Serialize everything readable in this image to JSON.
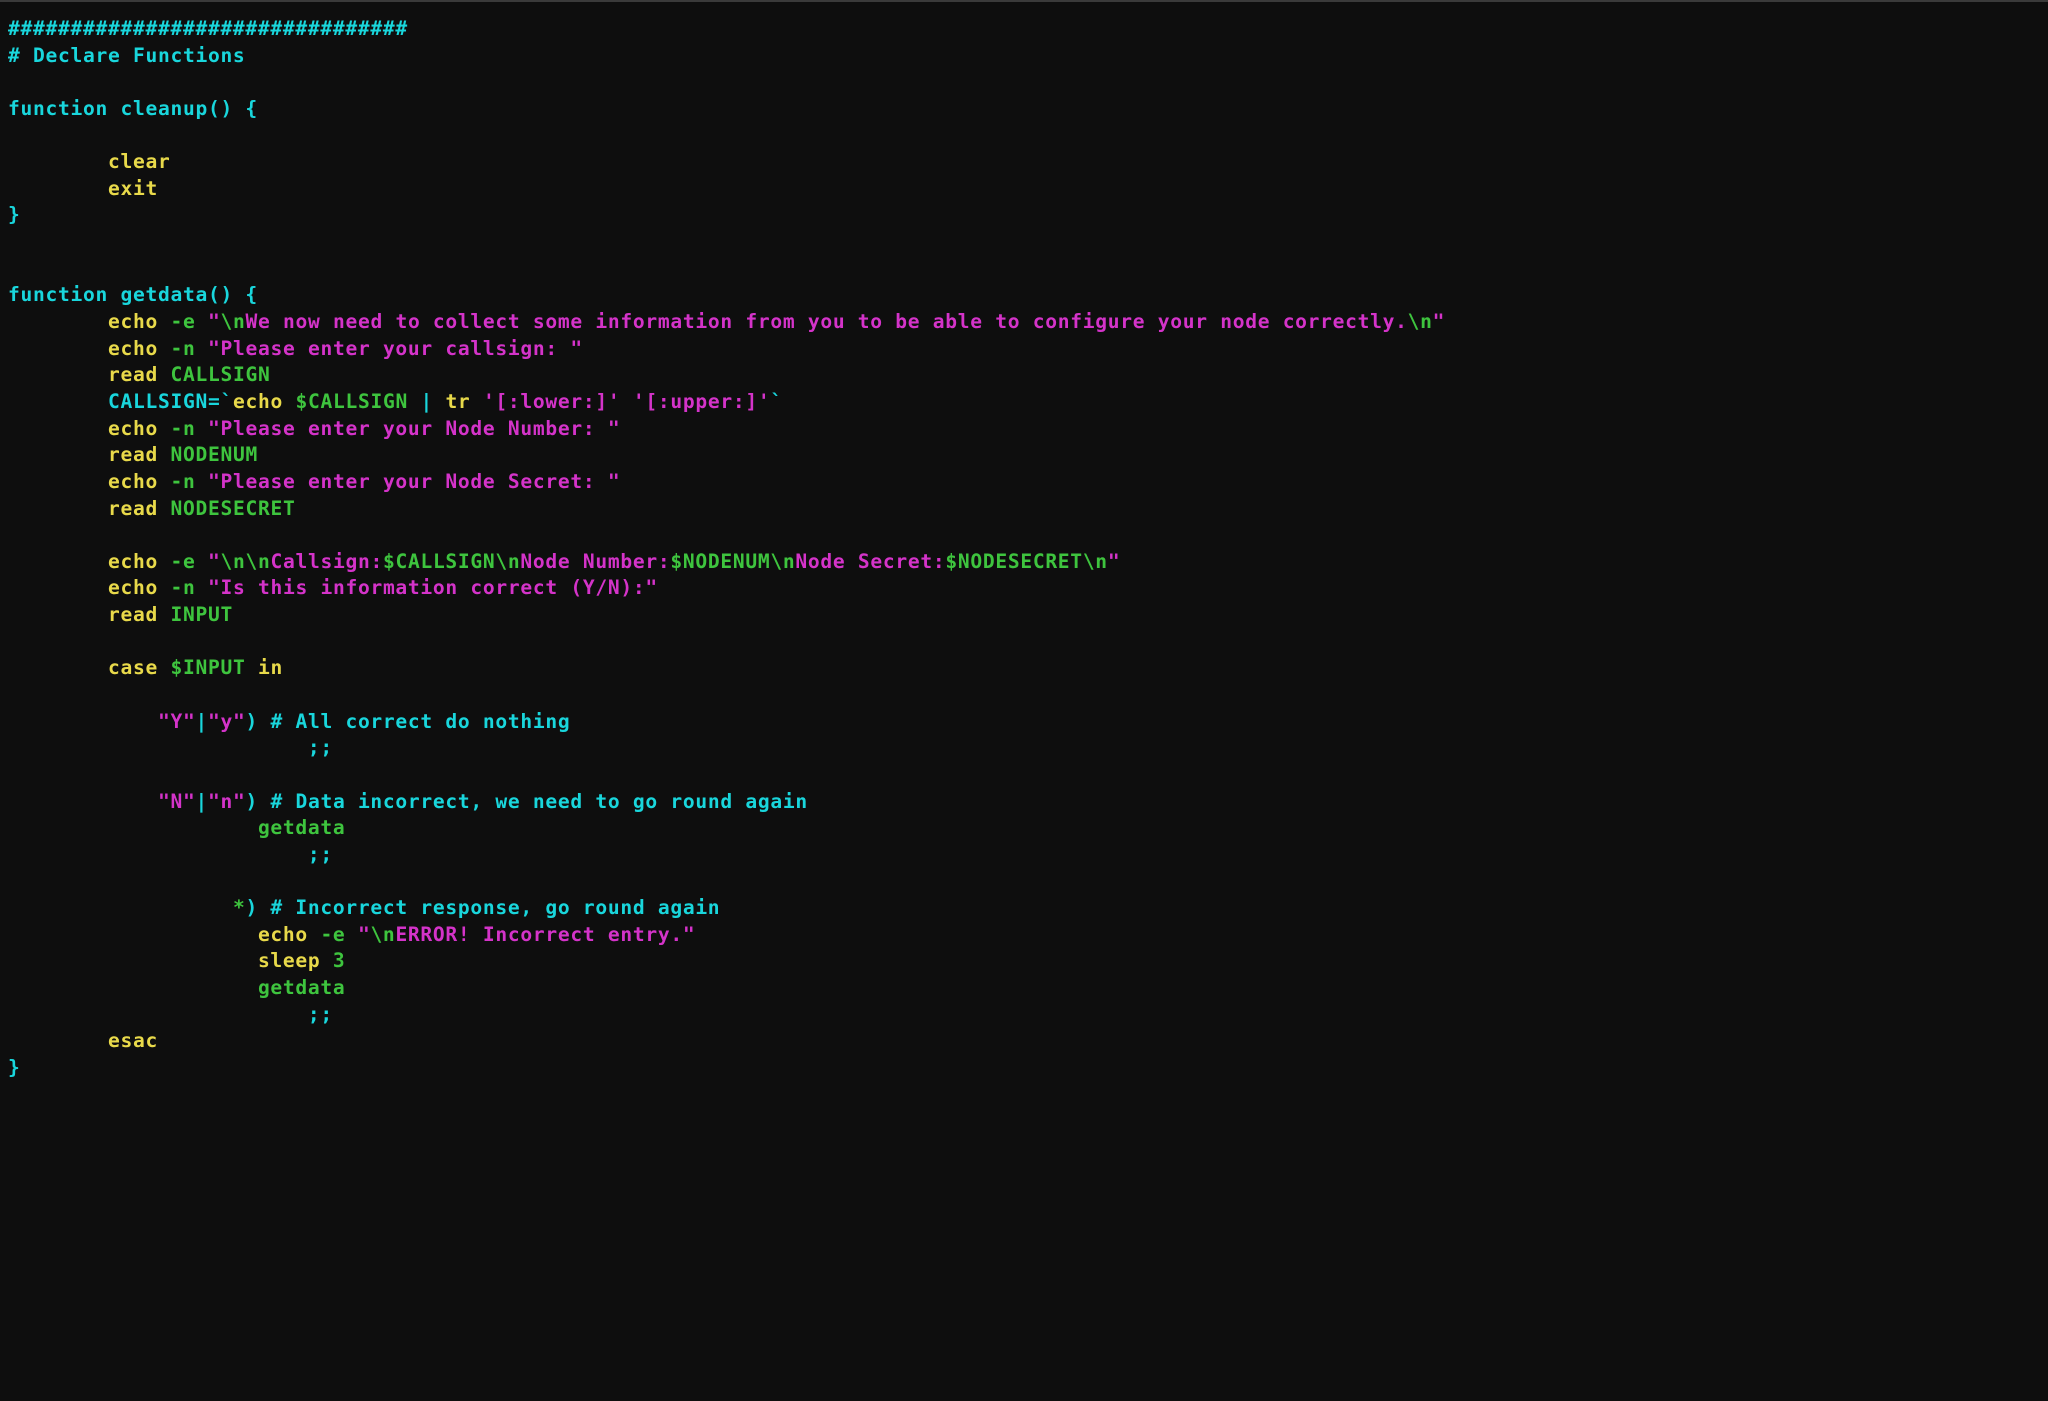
{
  "colors": {
    "background": "#0e0e0e",
    "comment": "#19d6dc",
    "keyword": "#19d6dc",
    "builtin": "#e8d94a",
    "string": "#d433c9",
    "variable": "#3ec43e"
  },
  "t": {
    "hash": "################################",
    "declare": "# Declare Functions",
    "fn_cleanup": "function cleanup() {",
    "clear": "clear",
    "exit": "exit",
    "brace_close": "}",
    "fn_getdata": "function getdata() {",
    "echo": "echo",
    "fe": "-e",
    "fn": "-n",
    "read": "read",
    "case": "case",
    "in": "in",
    "esac": "esac",
    "sleep": "sleep",
    "three": "3",
    "getdata_call": "getdata",
    "tr": "tr",
    "pipe": "|",
    "bt": "`",
    "dsemi": ";;",
    "rparen": ")",
    "star": "*",
    "eq": "=",
    "q": "\"",
    "s_info1a": "\\n",
    "s_info1b": "We now need to collect some information from you to be able to configure your node correctly.",
    "s_info1c": "\\n",
    "s_enter_callsign": "Please enter your callsign: ",
    "v_CALLSIGN": "CALLSIGN",
    "v_CALLSIGN_assign": "CALLSIGN",
    "v_CALLSIGN_ref": "$CALLSIGN",
    "s_lower": "'[:lower:]'",
    "s_upper": "'[:upper:]'",
    "s_enter_nodenum": "Please enter your Node Number: ",
    "v_NODENUM": "NODENUM",
    "s_enter_secret": "Please enter your Node Secret: ",
    "v_NODESECRET": "NODESECRET",
    "s_sum_a": "\\n\\n",
    "s_sum_b": "Callsign:",
    "v_sum_cs": "$CALLSIGN",
    "s_sum_c": "\\n",
    "s_sum_d": "Node Number:",
    "v_sum_nn": "$NODENUM",
    "s_sum_e": "\\n",
    "s_sum_f": "Node Secret:",
    "v_sum_ns": "$NODESECRET",
    "s_sum_g": "\\n",
    "s_confirm": "Is this information correct (Y/N):",
    "v_INPUT": "INPUT",
    "v_INPUT_ref": "$INPUT",
    "s_Y": "Y",
    "s_y": "y",
    "s_N": "N",
    "s_n": "n",
    "cmt_correct": " # All correct do nothing",
    "cmt_incorrect": " # Data incorrect, we need to go round again",
    "cmt_badresp": " # Incorrect response, go round again",
    "s_err_a": "\\n",
    "s_err_b": "ERROR! Incorrect entry."
  }
}
